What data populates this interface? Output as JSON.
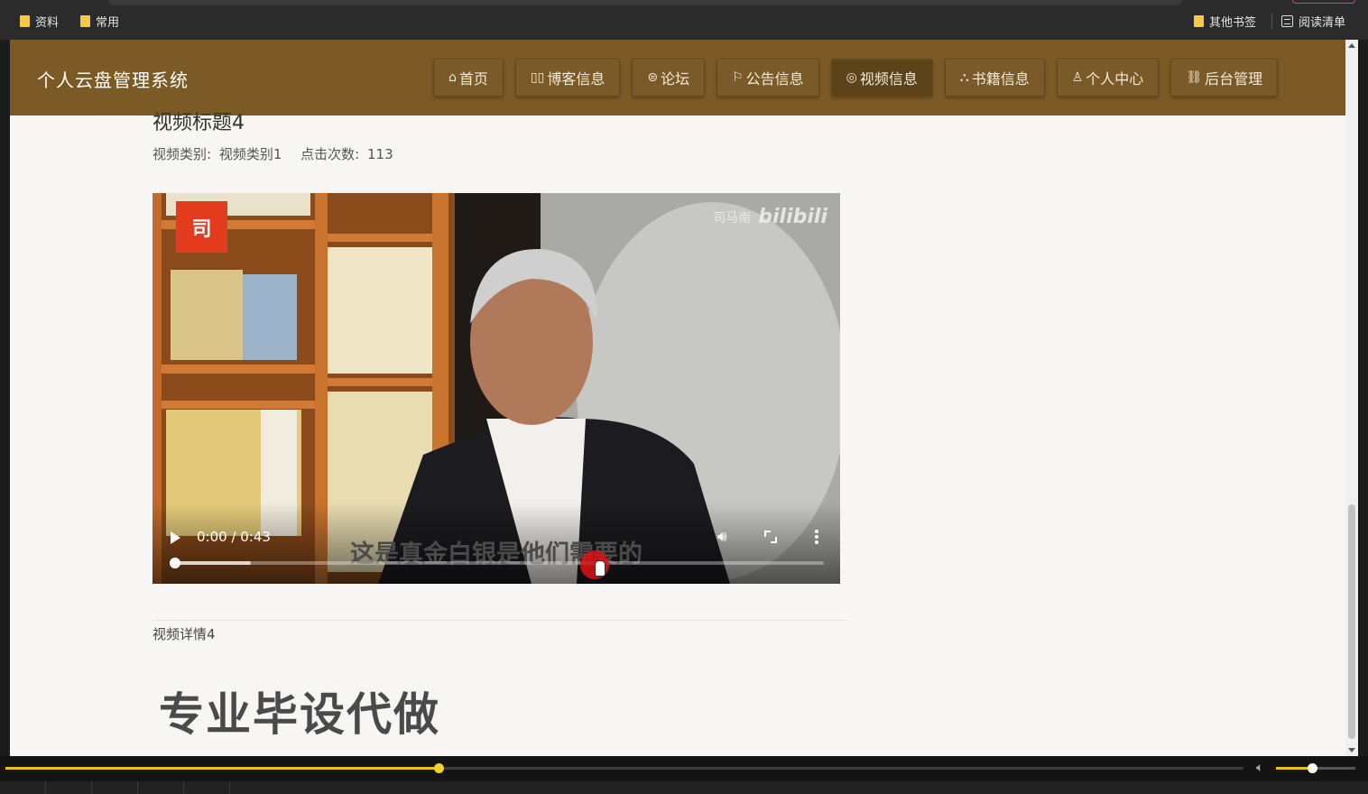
{
  "browser": {
    "bookmarks_left": [
      {
        "label": "资料",
        "icon": "folder-icon"
      },
      {
        "label": "常用",
        "icon": "folder-icon"
      }
    ],
    "bookmarks_right": [
      {
        "label": "其他书签",
        "icon": "folder-icon"
      },
      {
        "label": "阅读清单",
        "icon": "reading-list-icon"
      }
    ]
  },
  "header": {
    "site_title": "个人云盘管理系统",
    "nav": [
      {
        "label": "首页",
        "icon": "home-icon",
        "glyph": "⌂"
      },
      {
        "label": "博客信息",
        "icon": "book-icon",
        "glyph": "▯▯"
      },
      {
        "label": "论坛",
        "icon": "forum-icon",
        "glyph": "⊜"
      },
      {
        "label": "公告信息",
        "icon": "flag-icon",
        "glyph": "⚐"
      },
      {
        "label": "视频信息",
        "icon": "gamepad-icon",
        "glyph": "◎",
        "active": true
      },
      {
        "label": "书籍信息",
        "icon": "books-icon",
        "glyph": "⛬"
      },
      {
        "label": "个人中心",
        "icon": "user-icon",
        "glyph": "♙"
      },
      {
        "label": "后台管理",
        "icon": "link-icon",
        "glyph": "⛓"
      }
    ]
  },
  "video": {
    "title": "视频标题4",
    "category_label": "视频类别:",
    "category_value": "视频类别1",
    "clicks_label": "点击次数:",
    "clicks_value": "113",
    "player": {
      "logo_glyph": "司",
      "watermark_name": "司马南",
      "watermark_brand": "bilibili",
      "subtitle": "这是真金白银是他们需要的",
      "time": "0:00 / 0:43",
      "progress": 0.0,
      "buffered": 0.12
    },
    "detail": "视频详情4",
    "promo_text": "专业毕设代做"
  },
  "media_player": {
    "progress": 0.35,
    "volume": 0.45
  },
  "colors": {
    "nav_bg": "#7b5a26",
    "nav_active": "#5b4219",
    "page_bg": "#f8f6f5",
    "accent_yellow": "#e8c11a"
  }
}
